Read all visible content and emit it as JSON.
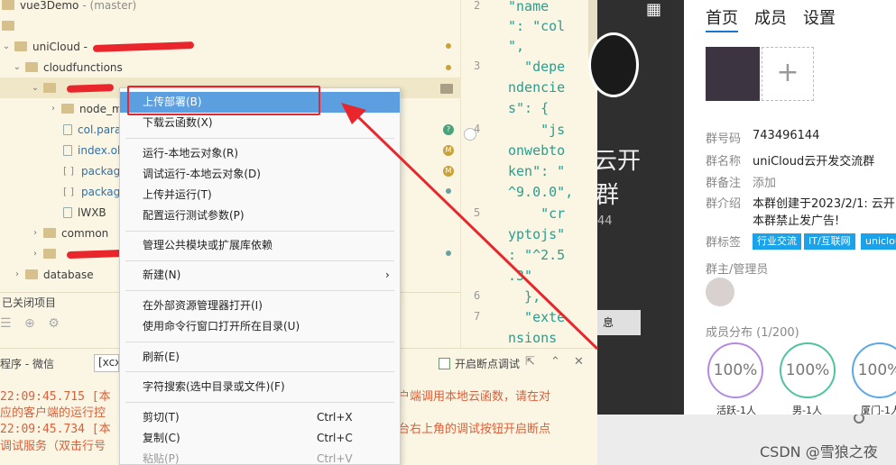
{
  "tree": {
    "rows": [
      {
        "label": "vue3Demo",
        "extra": "- (master)"
      },
      {
        "label": ""
      },
      {
        "label": "uniCloud -"
      },
      {
        "label": "cloudfunctions"
      },
      {
        "label": ""
      },
      {
        "label": "node_m"
      },
      {
        "label": "col.para"
      },
      {
        "label": "index.ob"
      },
      {
        "label": "package"
      },
      {
        "label": "package"
      },
      {
        "label": "lWXB"
      },
      {
        "label": "common"
      },
      {
        "label": ""
      },
      {
        "label": "database"
      }
    ],
    "badges": {
      "question": "?",
      "modified": "M"
    },
    "closed_projects": "已关闭项目"
  },
  "editor": {
    "line_numbers": [
      "2",
      "3",
      "4",
      "5",
      "6",
      "7"
    ],
    "code_lines": [
      "\"name",
      "\": \"col",
      "\",",
      "  \"depe",
      "ndencie",
      "s\": {",
      "    \"js",
      "onwebto",
      "ken\": \"",
      "^9.0.0\",",
      "    \"cr",
      "yptojs\"",
      ": \"^2.5",
      ".3\"",
      "  },",
      "  \"exte",
      "nsions"
    ]
  },
  "menu": {
    "items": [
      {
        "label": "上传部署(B)",
        "shortcut": ""
      },
      {
        "label": "下载云函数(X)",
        "shortcut": ""
      },
      {
        "label": "运行-本地云对象(R)",
        "shortcut": ""
      },
      {
        "label": "调试运行-本地云对象(D)",
        "shortcut": ""
      },
      {
        "label": "上传并运行(T)",
        "shortcut": ""
      },
      {
        "label": "配置运行测试参数(P)",
        "shortcut": ""
      },
      {
        "label": "管理公共模块或扩展库依赖",
        "shortcut": ""
      },
      {
        "label": "新建(N)",
        "shortcut": "",
        "submenu": "›"
      },
      {
        "label": "在外部资源管理器打开(I)",
        "shortcut": ""
      },
      {
        "label": "使用命令行窗口打开所在目录(U)",
        "shortcut": ""
      },
      {
        "label": "刷新(E)",
        "shortcut": ""
      },
      {
        "label": "字符搜索(选中目录或文件)(F)",
        "shortcut": ""
      },
      {
        "label": "剪切(T)",
        "shortcut": "Ctrl+X"
      },
      {
        "label": "复制(C)",
        "shortcut": "Ctrl+C"
      },
      {
        "label": "粘贴(P)",
        "shortcut": "Ctrl+V"
      }
    ]
  },
  "console": {
    "tab": "程序 - 微信",
    "tab2": "[xcx-",
    "breakpoint_label": "开启断点调试",
    "lines": [
      {
        "time": "22:09:45.715 [本",
        "tail": "户端调用本地云函数，请在对"
      },
      {
        "time": "应的客户端的运行控",
        "tail": ""
      },
      {
        "time": "22:09:45.734 [本",
        "tail": "台右上角的调试按钮开启断点"
      },
      {
        "time": "调试服务（双击行号",
        "tail": ""
      }
    ]
  },
  "dark": {
    "name1": "云开",
    "name2": "群",
    "count": "44",
    "button": "息"
  },
  "group": {
    "tabs": [
      "首页",
      "成员",
      "设置"
    ],
    "fields": [
      {
        "label": "群号码",
        "value": "743496144"
      },
      {
        "label": "群名称",
        "value": "uniCloud云开发交流群"
      },
      {
        "label": "群备注",
        "value": "添加"
      },
      {
        "label": "群介绍",
        "value": "本群创建于2023/2/1: 云开",
        "value2": "本群禁止发广告!"
      },
      {
        "label": "群标签",
        "value": ""
      }
    ],
    "tags": [
      "行业交流",
      "IT/互联网",
      "uniclou"
    ],
    "admin_label": "群主/管理员",
    "distribution_label": "成员分布 (1/200)",
    "circles": [
      {
        "value": "100%",
        "label": "活跃-1人",
        "color": "#b48be0"
      },
      {
        "value": "100%",
        "label": "男-1人",
        "color": "#4fc3a1"
      },
      {
        "value": "100%",
        "label": "厦门-1人",
        "color": "#5ba8e8"
      }
    ]
  },
  "watermark": "CSDN @雪狼之夜",
  "colors": {
    "annotation": "#e8262b",
    "menu_highlight": "#5c9fe0",
    "ide_bg": "#fbf6e4"
  }
}
